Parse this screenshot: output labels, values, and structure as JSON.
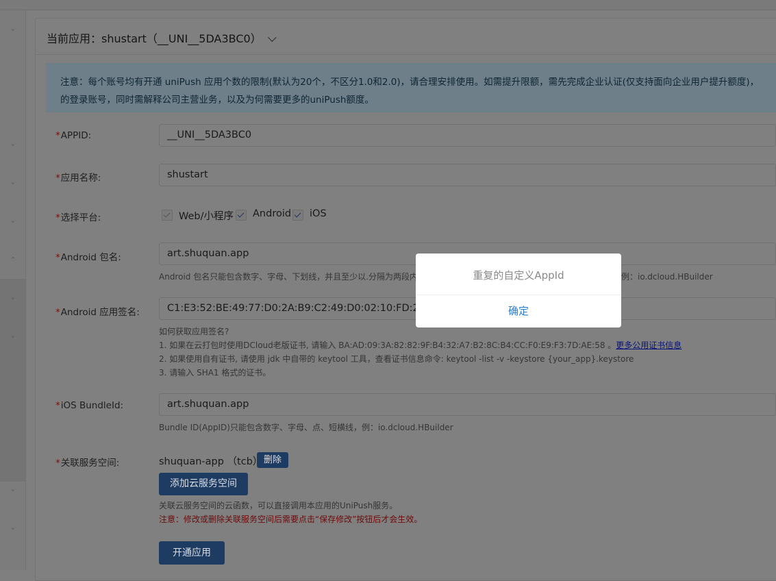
{
  "header": {
    "current_app_label": "当前应用：",
    "current_app_value": "shustart（__UNI__5DA3BC0）"
  },
  "notice": {
    "line1": "注意：每个账号均有开通 uniPush 应用个数的限制(默认为20个，不区分1.0和2.0)，请合理安排使用。如需提升限额，需先完成企业认证(仅支持面向企业用户提升额度)，",
    "line2": "的登录账号，同时需解释公司主营业务，以及为何需要更多的uniPush额度。"
  },
  "form": {
    "required_mark": "*",
    "appid": {
      "label": "APPID:",
      "value": "__UNI__5DA3BC0"
    },
    "app_name": {
      "label": "应用名称:",
      "value": "shustart"
    },
    "platform": {
      "label": "选择平台:",
      "options": [
        {
          "label": "Web/小程序",
          "checked": true,
          "disabled": true
        },
        {
          "label": "Android",
          "checked": true,
          "disabled": false
        },
        {
          "label": "iOS",
          "checked": true,
          "disabled": false
        }
      ]
    },
    "android_package": {
      "label": "Android 包名:",
      "value": "art.shuquan.app",
      "hint_left": "Android 包名只能包含数字、字母、下划线，并且至少以.分隔为两段内",
      "hint_right": "例：io.dcloud.HBuilder"
    },
    "android_sign": {
      "label": "Android 应用签名:",
      "value": "C1:E3:52:BE:49:77:D0:2A:B9:C2:49:D0:02:10:FD:22:2B:84",
      "help_title": "如何获取应用签名?",
      "help_1": "1. 如果在云打包时使用DCloud老版证书, 请输入 BA:AD:09:3A:82:82:9F:B4:32:A7:B2:8C:B4:CC:F0:E9:F3:7D:AE:58 。",
      "help_1_link": "更多公用证书信息",
      "help_2": "2. 如果使用自有证书, 请使用 jdk 中自带的 keytool 工具，查看证书信息命令: keytool -list -v -keystore {your_app}.keystore",
      "help_3": "3. 请输入 SHA1 格式的证书。"
    },
    "ios_bundle": {
      "label": "iOS BundleId:",
      "value": "art.shuquan.app",
      "hint": "Bundle ID(AppID)只能包含数字、字母、点、短横线，例：io.dcloud.HBuilder"
    },
    "service_space": {
      "label": "关联服务空间:",
      "value": "shuquan-app （tcb）",
      "delete_label": "删除",
      "add_label": "添加云服务空间",
      "hint": "关联云服务空间的云函数，可以直接调用本应用的UniPush服务。",
      "warning": "注意：修改或删除关联服务空间后需要点击“保存修改”按钮后才会生效。"
    },
    "submit_label": "开通应用"
  },
  "dialog": {
    "message": "重复的自定义AppId",
    "confirm_label": "确定"
  },
  "sidebar": {
    "chevron_icons": [
      "chevron-down-icon",
      "chevron-down-icon",
      "chevron-down-icon",
      "chevron-down-icon",
      "chevron-up-icon",
      "chevron-down-icon",
      "chevron-down-icon",
      "chevron-down-icon",
      "chevron-down-icon"
    ]
  },
  "colors": {
    "overlay_bg": "#7f7f7f",
    "dialog_bg": "#ffffff",
    "primary_button": "#1e3c62",
    "link_blue": "#2b7fd3",
    "warning_red": "#6e0a0a"
  }
}
